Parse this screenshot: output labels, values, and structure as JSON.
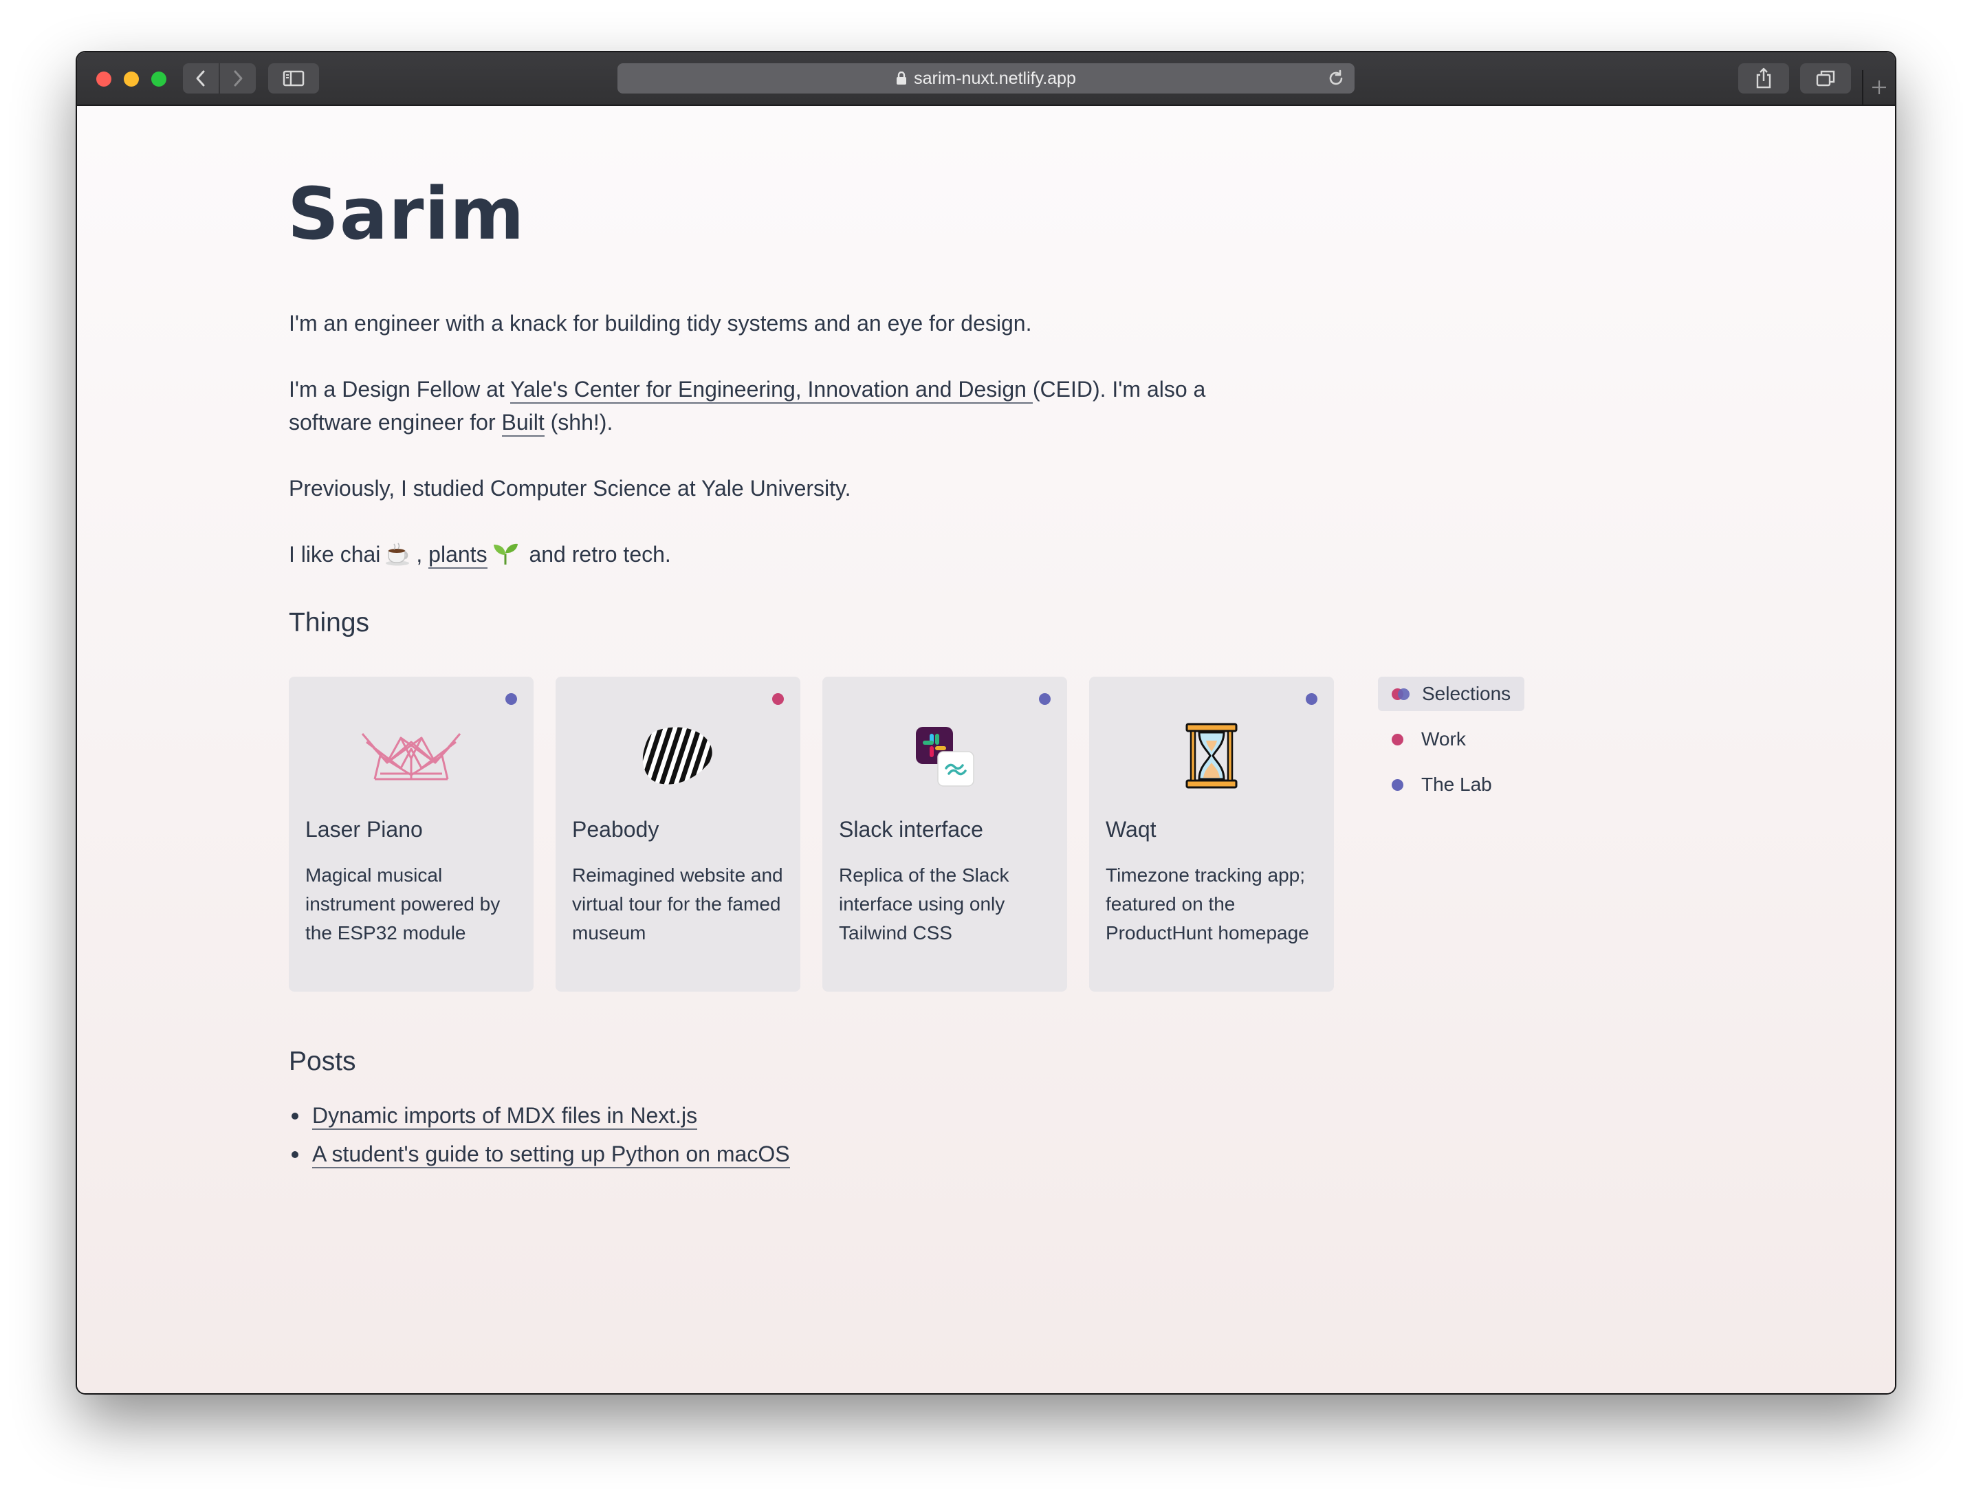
{
  "browser": {
    "url": "sarim-nuxt.netlify.app"
  },
  "site": {
    "title": "Sarim"
  },
  "intro": {
    "p1": "I'm an engineer with a knack for building tidy systems and an eye for design.",
    "p2_before": "I'm a Design Fellow at ",
    "p2_link": "Yale's Center for Engineering, Innovation and Design ",
    "p2_middle": "(CEID). I'm also a software engineer for ",
    "p2_link2": "Built",
    "p2_after": " (shh!).",
    "p3": "Previously, I studied Computer Science at Yale University.",
    "p4_before": "I like chai",
    "p4_comma": ", ",
    "p4_link": "plants",
    "p4_after": " and retro tech."
  },
  "things": {
    "heading": "Things",
    "cards": [
      {
        "title": "Laser Piano",
        "description": "Magical musical instrument powered by the ESP32 module",
        "icon": "crown-lattice-icon",
        "category_color": "#6466b8"
      },
      {
        "title": "Peabody",
        "description": "Reimagined website and virtual tour for the famed museum",
        "icon": "striped-shell-icon",
        "category_color": "#c84272"
      },
      {
        "title": "Slack interface",
        "description": "Replica of the Slack interface using only Tailwind CSS",
        "icon": "slack-tailwind-icon",
        "category_color": "#6466b8"
      },
      {
        "title": "Waqt",
        "description": "Timezone tracking app; featured on the ProductHunt homepage",
        "icon": "hourglass-icon",
        "category_color": "#6466b8"
      }
    ]
  },
  "filters": {
    "items": [
      {
        "label": "Selections",
        "active": true
      },
      {
        "label": "Work",
        "color": "#c84272"
      },
      {
        "label": "The Lab",
        "color": "#6466b8"
      }
    ]
  },
  "posts": {
    "heading": "Posts",
    "items": [
      "Dynamic imports of MDX files in Next.js",
      "A student's guide to setting up Python on macOS"
    ]
  },
  "colors": {
    "work": "#c84272",
    "lab": "#6466b8",
    "text": "#2d3748"
  }
}
